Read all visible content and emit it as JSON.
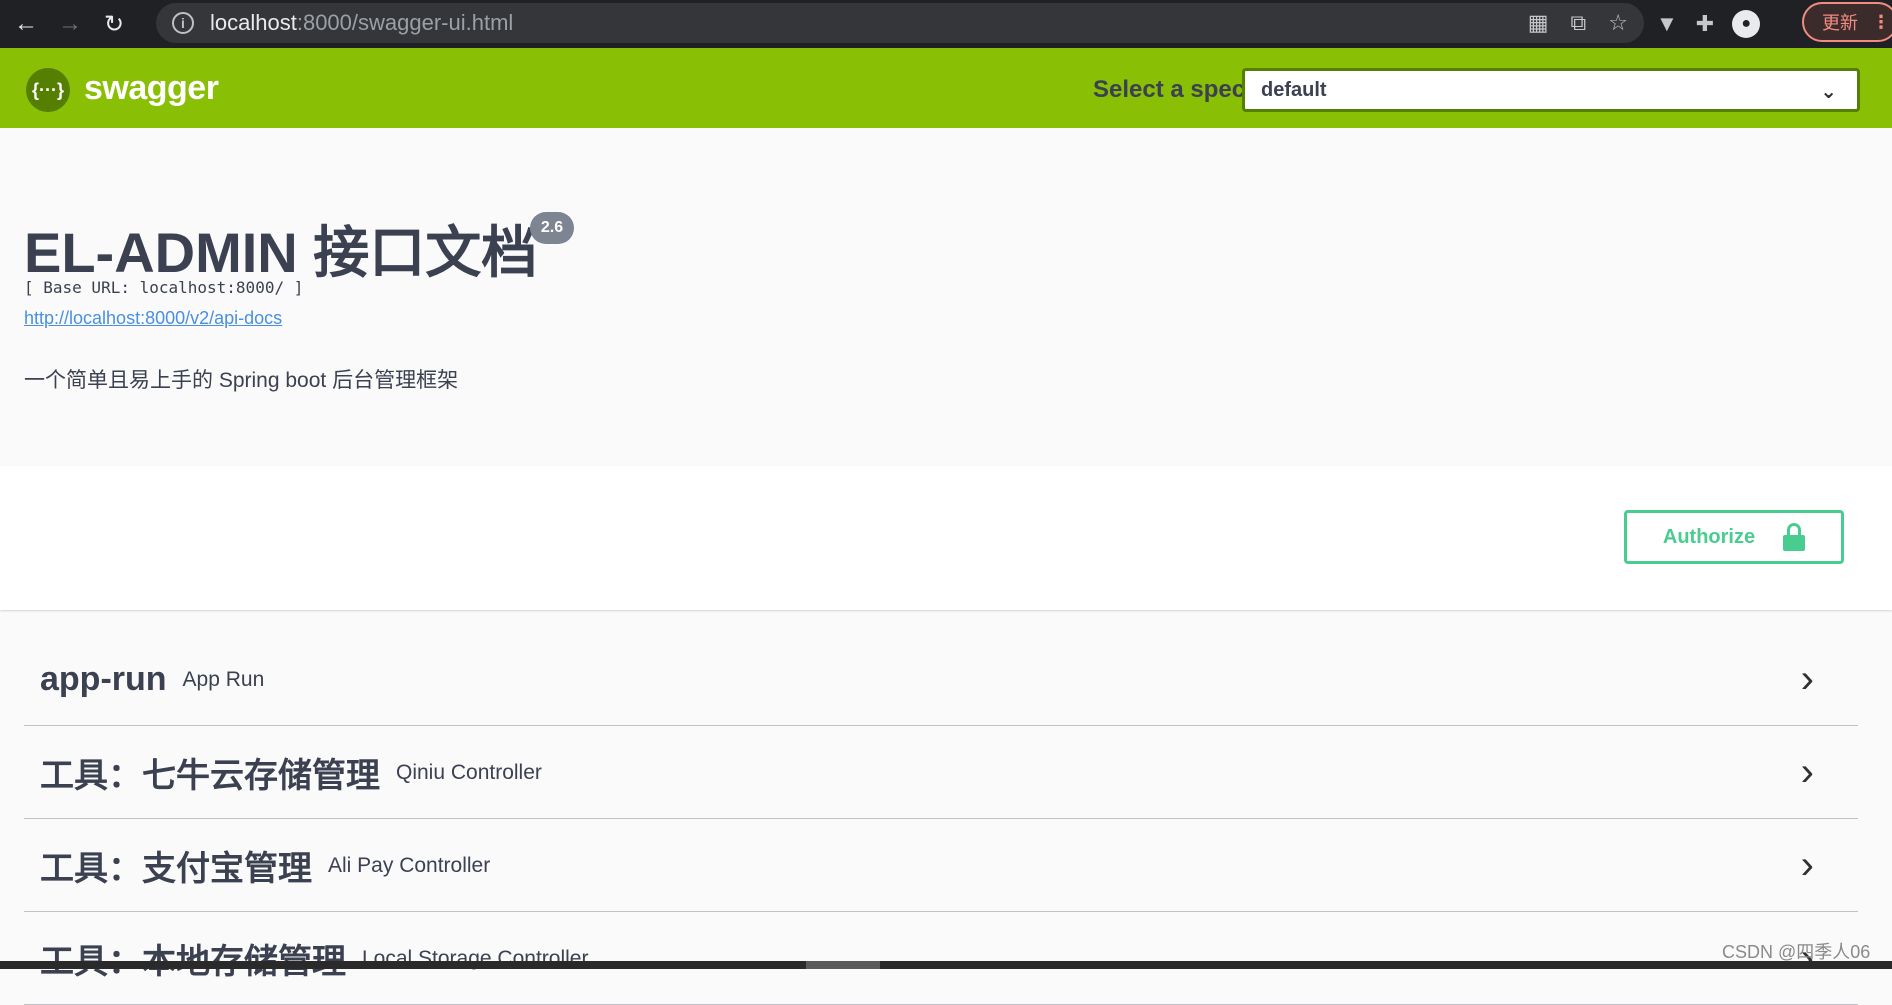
{
  "browser": {
    "url_host": "localhost",
    "url_rest": ":8000/swagger-ui.html",
    "update_label": "更新"
  },
  "topbar": {
    "logo_symbol": "{···}",
    "logo_text": "swagger",
    "spec_label": "Select a spec",
    "spec_value": "default"
  },
  "info": {
    "title": "EL-ADMIN 接口文档",
    "version": "2.6",
    "base_url": "[ Base URL: localhost:8000/ ]",
    "api_docs_link": "http://localhost:8000/v2/api-docs",
    "description": "一个简单且易上手的 Spring boot 后台管理框架"
  },
  "authorize": {
    "label": "Authorize"
  },
  "tags": [
    {
      "name": "app-run",
      "desc": "App Run"
    },
    {
      "name": "工具：七牛云存储管理",
      "desc": "Qiniu Controller"
    },
    {
      "name": "工具：支付宝管理",
      "desc": "Ali Pay Controller"
    },
    {
      "name": "工具：本地存储管理",
      "desc": "Local Storage Controller"
    }
  ],
  "watermark": "CSDN @四季人06",
  "colors": {
    "topbar": "#89bf04",
    "accent_green": "#49cc90",
    "text": "#3b4151",
    "link": "#4990e2"
  }
}
